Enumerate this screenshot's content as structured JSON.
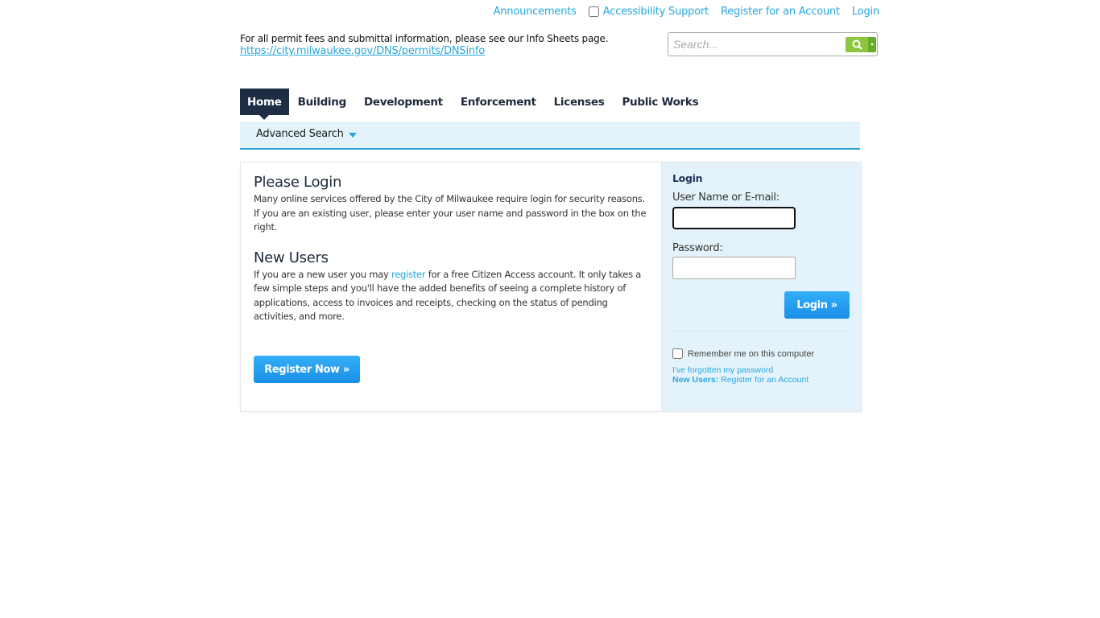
{
  "top_links": {
    "announcements": "Announcements",
    "accessibility": "Accessibility Support",
    "accessibility_checked": false,
    "register": "Register for an Account",
    "login": "Login"
  },
  "info": {
    "text": "For all permit fees and submittal information, please see our Info Sheets page.",
    "link": "https://city.milwaukee.gov/DNS/permits/DNSinfo"
  },
  "search": {
    "placeholder": "Search...",
    "value": "",
    "button_icon": "search-icon",
    "dropdown_icon": "caret-down-icon"
  },
  "nav": {
    "tabs": [
      {
        "label": "Home",
        "active": true
      },
      {
        "label": "Building",
        "active": false
      },
      {
        "label": "Development",
        "active": false
      },
      {
        "label": "Enforcement",
        "active": false
      },
      {
        "label": "Licenses",
        "active": false
      },
      {
        "label": "Public Works",
        "active": false
      }
    ],
    "subnav": {
      "advanced_search": "Advanced Search"
    }
  },
  "main": {
    "please_login": {
      "heading": "Please Login",
      "text": "Many online services offered by the City of Milwaukee require login for security reasons. If you are an existing user, please enter your user name and password in the box on the right."
    },
    "new_users": {
      "heading": "New Users",
      "text_before": "If you are a new user you may ",
      "link": "register",
      "text_after": " for a free Citizen Access account. It only takes a few simple steps and you'll have the added benefits of seeing a complete history of applications, access to invoices and receipts, checking on the status of pending activities, and more."
    },
    "register_button": "Register Now »"
  },
  "login_box": {
    "title": "Login",
    "username_label": "User Name or E-mail:",
    "username_value": "",
    "password_label": "Password:",
    "password_value": "",
    "login_button": "Login »",
    "remember_label": "Remember me on this computer",
    "remember_checked": false,
    "forgot_link": "I've forgotten my password",
    "new_users_label": "New Users:",
    "new_users_link": "Register for an Account"
  },
  "colors": {
    "link": "#27a7df",
    "nav_active": "#1f2d44",
    "subnav_bg": "#e4f3fb",
    "button": "#1a8fe8",
    "search_button": "#8cc63f"
  }
}
